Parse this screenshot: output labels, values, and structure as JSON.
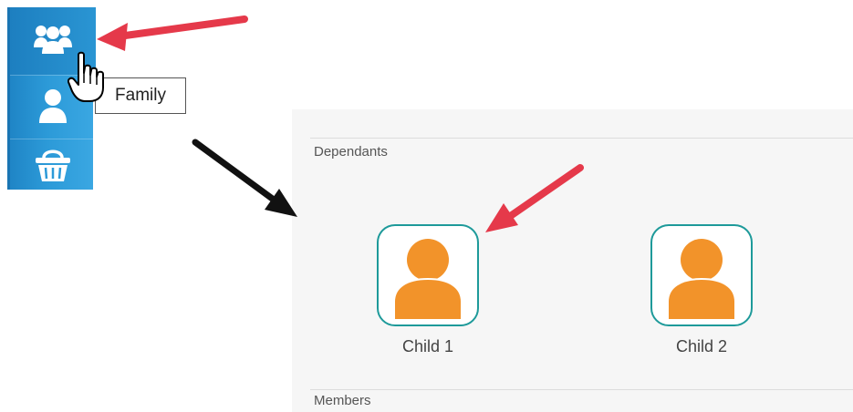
{
  "sidebar": {
    "items": [
      {
        "name": "family",
        "icon": "family-icon"
      },
      {
        "name": "user",
        "icon": "user-icon"
      },
      {
        "name": "basket",
        "icon": "basket-icon"
      }
    ],
    "tooltip": "Family"
  },
  "panel": {
    "dependants_label": "Dependants",
    "members_label": "Members",
    "children": [
      {
        "label": "Child 1",
        "icon": "person-icon"
      },
      {
        "label": "Child 2",
        "icon": "person-icon"
      }
    ]
  },
  "colors": {
    "sidebar_blue": "#2c9ad8",
    "card_border": "#1e9a9a",
    "person_orange": "#f2932a",
    "annotation_red": "#e5394a",
    "annotation_black": "#111111"
  }
}
